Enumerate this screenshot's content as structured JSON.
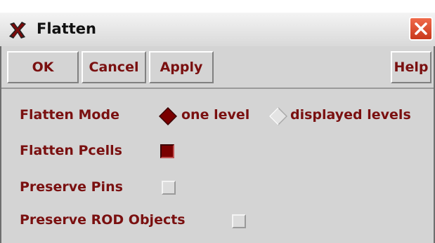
{
  "window": {
    "title": "Flatten",
    "close_icon": "close-icon",
    "app_icon": "x-tool-icon"
  },
  "toolbar": {
    "ok_label": "OK",
    "cancel_label": "Cancel",
    "apply_label": "Apply",
    "help_label": "Help"
  },
  "form": {
    "flatten_mode": {
      "label": "Flatten Mode",
      "options": [
        {
          "label": "one level",
          "selected": true
        },
        {
          "label": "displayed levels",
          "selected": false
        }
      ]
    },
    "flatten_pcells": {
      "label": "Flatten Pcells",
      "checked": true
    },
    "preserve_pins": {
      "label": "Preserve Pins",
      "checked": false
    },
    "preserve_rod_objects": {
      "label": "Preserve ROD Objects",
      "checked": false
    }
  },
  "colors": {
    "label_text": "#7a1010",
    "panel_bg": "#d4d4d4",
    "checked_fill": "#7a0000"
  }
}
